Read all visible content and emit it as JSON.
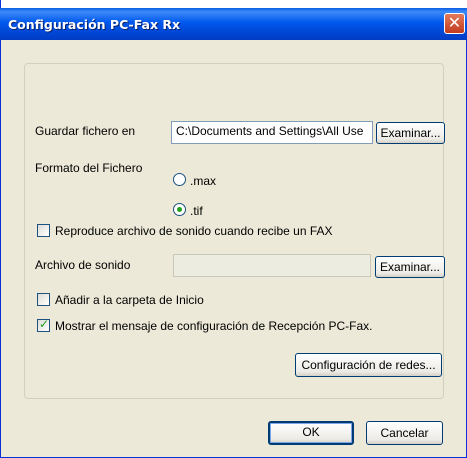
{
  "window": {
    "title": "Configuración PC-Fax Rx",
    "close_glyph": "✕"
  },
  "save": {
    "label": "Guardar fichero en",
    "path": "C:\\Documents and Settings\\All Use",
    "browse_label": "Examinar..."
  },
  "format": {
    "label": "Formato del Fichero",
    "options": [
      {
        "label": ".max",
        "selected": false
      },
      {
        "label": ".tif",
        "selected": true
      }
    ]
  },
  "sound_checkbox": {
    "label": "Reproduce archivo de sonido cuando recibe un FAX",
    "checked": false
  },
  "sound_file": {
    "label": "Archivo de sonido",
    "value": "",
    "browse_label": "Examinar..."
  },
  "startup_checkbox": {
    "label": "Añadir a la carpeta de Inicio",
    "checked": false
  },
  "config_msg_checkbox": {
    "label": "Mostrar el mensaje de configuración de Recepción PC-Fax.",
    "checked": true
  },
  "network_button": {
    "label": "Configuración de redes..."
  },
  "ok_button": {
    "label": "OK"
  },
  "cancel_button": {
    "label": "Cancelar"
  },
  "colors": {
    "titlebar": "#0058ee",
    "dialog_bg": "#ece9d8",
    "check_green": "#21a121"
  }
}
